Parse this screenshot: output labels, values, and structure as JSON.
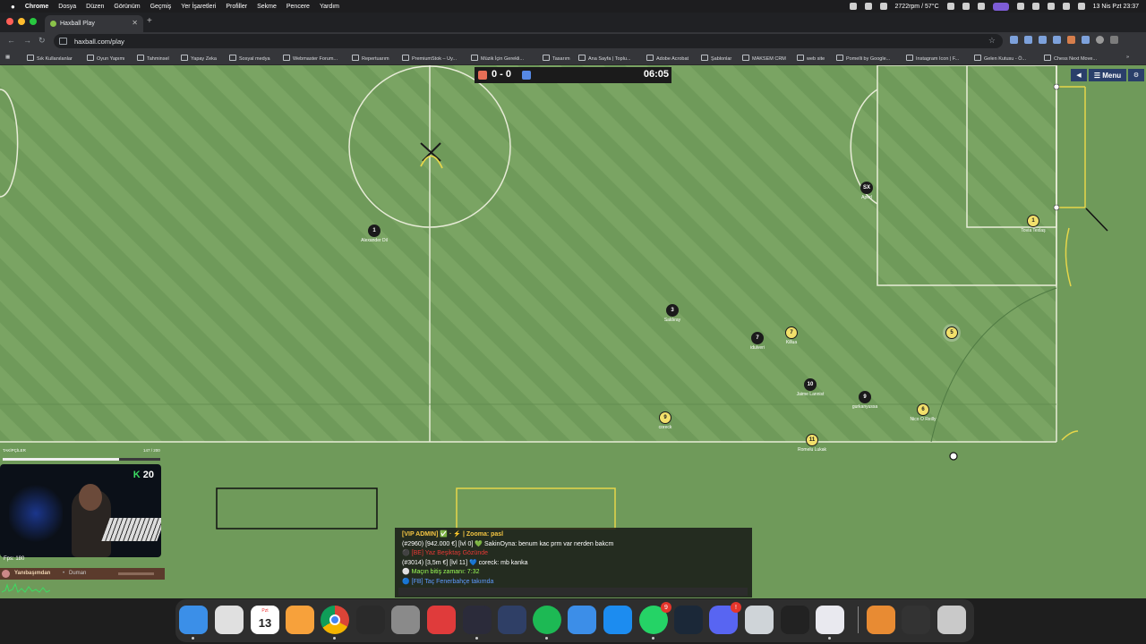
{
  "menubar": {
    "app": "Chrome",
    "items": [
      "Dosya",
      "Düzen",
      "Görünüm",
      "Geçmiş",
      "Yer İşaretleri",
      "Profiller",
      "Sekme",
      "Pencere",
      "Yardım"
    ],
    "system_status": "2722rpm / 57°C",
    "datetime": "13 Nis Pzt 23:37"
  },
  "browser": {
    "tab_title": "Haxball Play",
    "url": "haxball.com/play",
    "bookmarks": [
      "Sık Kullanılanlar",
      "Oyun Yapımı",
      "Tahminsel",
      "Yapay Zeka",
      "Sosyal medya",
      "Webmaster Forum...",
      "Repertuarım",
      "PremiumStok – Uy...",
      "Müzik İçin Gerekli...",
      "Tasarım",
      "Ana Sayfa | Toplu...",
      "Adobe Acrobat",
      "Şablonlar",
      "MAKSEM CRM",
      "web site",
      "Pomelli by Google...",
      "Instagram Icon | F...",
      "Gelen Kutusu - Ö...",
      "Chess Next Move..."
    ]
  },
  "game": {
    "score": "0 - 0",
    "timer": "06:05",
    "menu_label": "☰ Menu",
    "colors": {
      "field": "#6f9a5a",
      "red_team": "#1b1b1b",
      "blue_team": "#e8d44a",
      "hud_red": "#e56e56",
      "hud_blue": "#5689e5"
    },
    "players": [
      {
        "number": "1",
        "name": "Alexander Dil",
        "team": "dark"
      },
      {
        "number": "3",
        "name": "Saldıray",
        "team": "dark"
      },
      {
        "number": "7",
        "name": "idulveri",
        "team": "dark"
      },
      {
        "number": "7",
        "name": "Killua",
        "team": "yellow"
      },
      {
        "number": "10",
        "name": "Jaime Lannist",
        "team": "dark"
      },
      {
        "number": "9",
        "name": "gurkanyussa",
        "team": "dark"
      },
      {
        "number": "6",
        "name": "Nico O Reilly",
        "team": "yellow"
      },
      {
        "number": "9",
        "name": "coreck",
        "team": "yellow"
      },
      {
        "number": "11",
        "name": "Romelu Lukak",
        "team": "yellow"
      },
      {
        "number": "SX",
        "name": "Aped",
        "team": "dark"
      },
      {
        "number": "1",
        "name": "Tovia Texlaş",
        "team": "yellow"
      },
      {
        "number": "5",
        "name": "",
        "team": "yellow"
      }
    ]
  },
  "overlay": {
    "followers_label": "TAKİPÇİLER",
    "followers_value": "147 / 200",
    "kick_count": "20",
    "fps": "Fps: 180",
    "weather_city": "Yanıbaşımdan",
    "weather_condition": "Duman"
  },
  "chat": {
    "lines": [
      {
        "text": "[VIP ADMIN] ✅ · ⚡ | Zooma: pasl",
        "color": "#f4c542"
      },
      {
        "text": "(#2960) [942.000 €] [lvl 0] 💚 SakinOyna: benum kac prm var nerden bakcm",
        "color": "#ffffff"
      },
      {
        "text": "⚫ [BE] Yaz Beşiktaş Gözünde",
        "color": "#e53935"
      },
      {
        "text": "(#3014) [3,5m €] [lvl 11] 💙 coreck: mb kanka",
        "color": "#ffffff"
      },
      {
        "text": "⚪ Maçın bitiş zamanı: 7:32",
        "color": "#9cff57"
      },
      {
        "text": "🔵 [FB] Taç Fenerbahçe takımda",
        "color": "#5e9bff"
      }
    ]
  },
  "dock": {
    "apps": [
      "finder",
      "launchpad",
      "calendar",
      "pages",
      "chrome",
      "chatgpt",
      "system-settings",
      "mirror",
      "obs",
      "arc",
      "spotify",
      "mail",
      "app-store",
      "whatsapp",
      "steam",
      "discord",
      "perplexity",
      "terminal",
      "figma-mirror",
      "downloads",
      "screen-share",
      "trash"
    ],
    "calendar_month": "Pzt",
    "calendar_day": "13",
    "whatsapp_badge": "9",
    "discord_badge": "!"
  }
}
